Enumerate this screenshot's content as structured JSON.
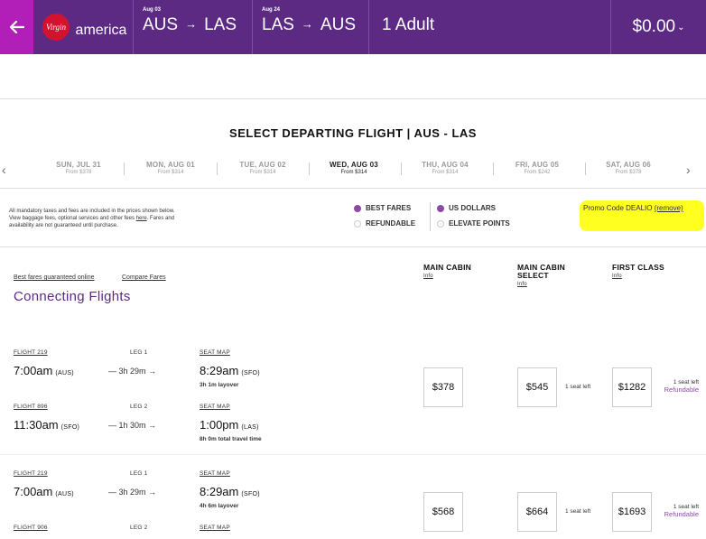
{
  "header": {
    "logo_script": "Virgin",
    "logo_text": "america",
    "outbound": {
      "date": "Aug 03",
      "from": "AUS",
      "arrow": "→",
      "to": "LAS"
    },
    "inbound": {
      "date": "Aug 24",
      "from": "LAS",
      "arrow": "→",
      "to": "AUS"
    },
    "passengers": "1 Adult",
    "total": "$0.00",
    "total_chevron": "⌄",
    "back_icon": "arrow-left-icon"
  },
  "title": "SELECT DEPARTING FLIGHT | AUS - LAS",
  "dates": [
    {
      "day": "SUN, JUL 31",
      "price": "From $378"
    },
    {
      "day": "MON, AUG 01",
      "price": "From $314"
    },
    {
      "day": "TUE, AUG 02",
      "price": "From $314"
    },
    {
      "day": "WED, AUG 03",
      "price": "From $314"
    },
    {
      "day": "THU, AUG 04",
      "price": "From $314"
    },
    {
      "day": "FRI, AUG 05",
      "price": "From $242"
    },
    {
      "day": "SAT, AUG 06",
      "price": "From $378"
    }
  ],
  "disclaimer": {
    "line1": "All mandatory taxes and fees are included in the prices shown below.",
    "line2a": "View baggage fees, optional services and other fees ",
    "here": "here",
    "line2b": ". Fares and",
    "line3": "availability are not guaranteed until purchase."
  },
  "options": {
    "best_fares": "BEST FARES",
    "refundable": "REFUNDABLE",
    "us_dollars": "US DOLLARS",
    "elevate_points": "ELEVATE POINTS"
  },
  "promo": {
    "text": "Promo Code DEALIO ",
    "remove": "(remove)"
  },
  "links": {
    "best_fares_guaranteed": "Best fares guaranteed online",
    "compare_fares": "Compare Fares"
  },
  "section_title": "Connecting Flights",
  "columns": {
    "main_cabin": {
      "line1": "MAIN CABIN",
      "info": "Info"
    },
    "main_cabin_select": {
      "line1": "MAIN CABIN",
      "line2": "SELECT",
      "info": "Info"
    },
    "first_class": {
      "line1": "FIRST CLASS",
      "info": "Info"
    }
  },
  "itineraries": [
    {
      "legs": [
        {
          "flight": "FLIGHT 219",
          "leg": "LEG 1",
          "dep": "7:00am",
          "dep_ap": "(AUS)",
          "dur": "— 3h 29m →",
          "seatmap": "SEAT MAP",
          "arr": "8:29am",
          "arr_ap": "(SFO)",
          "note": "3h 1m layover"
        },
        {
          "flight": "FLIGHT 896",
          "leg": "LEG 2",
          "dep": "11:30am",
          "dep_ap": "(SFO)",
          "dur": "— 1h 30m →",
          "seatmap": "SEAT MAP",
          "arr": "1:00pm",
          "arr_ap": "(LAS)",
          "note": "8h 0m total travel time"
        }
      ],
      "main": "$378",
      "select": "$545",
      "select_seats": "1 seat left",
      "first": "$1282",
      "first_seats": "1 seat left",
      "first_refundable": "Refundable"
    },
    {
      "legs": [
        {
          "flight": "FLIGHT 219",
          "leg": "LEG 1",
          "dep": "7:00am",
          "dep_ap": "(AUS)",
          "dur": "— 3h 29m →",
          "seatmap": "SEAT MAP",
          "arr": "8:29am",
          "arr_ap": "(SFO)",
          "note": "4h 6m layover"
        },
        {
          "flight": "FLIGHT 906",
          "leg": "LEG 2",
          "seatmap": "SEAT MAP"
        }
      ],
      "main": "$568",
      "select": "$664",
      "select_seats": "1 seat left",
      "first": "$1693",
      "first_seats": "1 seat left",
      "first_refundable": "Refundable"
    }
  ]
}
